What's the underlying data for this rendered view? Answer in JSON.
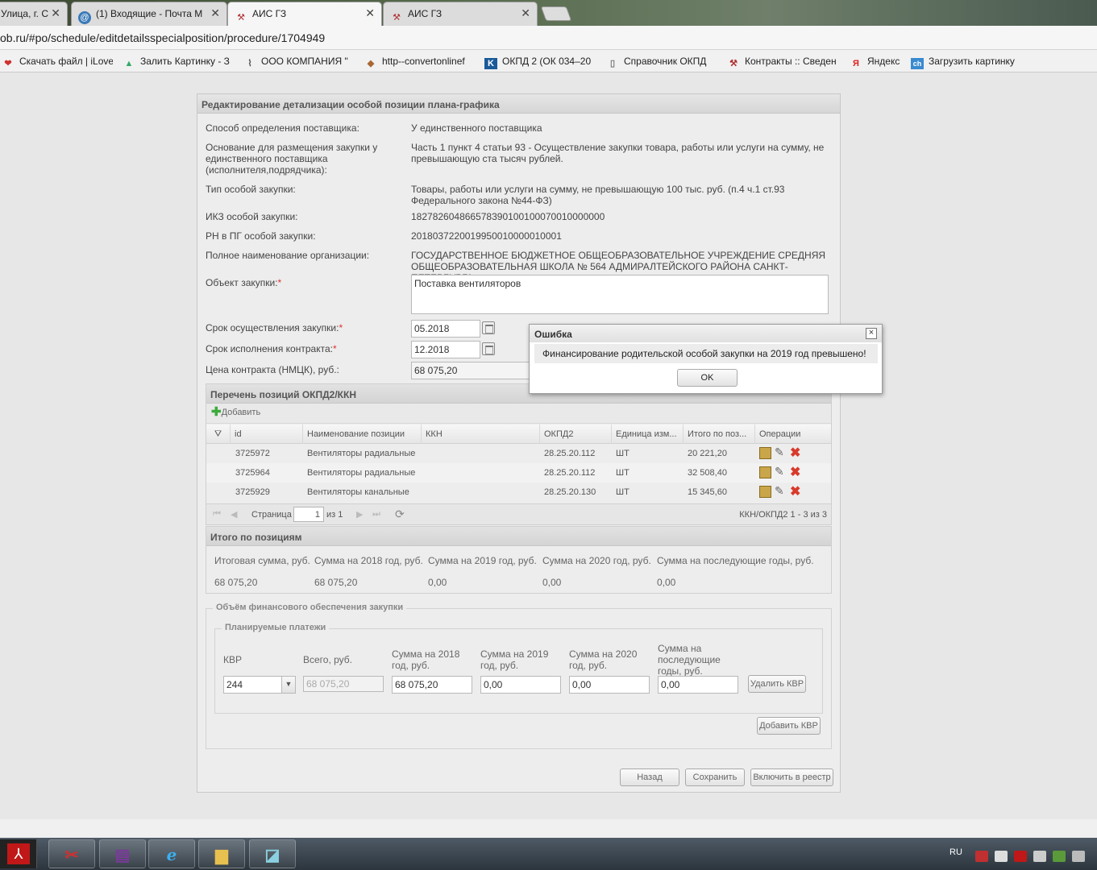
{
  "browser": {
    "tabs": [
      {
        "label": "Улица, г. С",
        "active": false,
        "icon": "map-icon"
      },
      {
        "label": "(1) Входящие - Почта M",
        "active": false,
        "icon": "mail-icon"
      },
      {
        "label": "АИС ГЗ",
        "active": true,
        "icon": "gavel-icon"
      },
      {
        "label": "АИС ГЗ",
        "active": false,
        "icon": "gavel-icon"
      }
    ],
    "address": "ob.ru/#po/schedule/editdetailsspecialposition/procedure/1704949",
    "bookmarks": [
      {
        "label": "Скачать файл | iLove",
        "icon": "heart-icon"
      },
      {
        "label": "Залить Картинку - З",
        "icon": "image-icon"
      },
      {
        "label": "ООО КОМПАНИЯ \"",
        "icon": "paperclip-icon"
      },
      {
        "label": "http--convertonlinef",
        "icon": "convert-icon"
      },
      {
        "label": "ОКПД 2 (ОК 034–20",
        "icon": "k-icon"
      },
      {
        "label": "Справочник ОКПД",
        "icon": "page-icon"
      },
      {
        "label": "Контракты :: Сведен",
        "icon": "gavel-icon"
      },
      {
        "label": "Яндекс",
        "icon": "yandex-icon"
      },
      {
        "label": "Загрузить картинку",
        "icon": "ch-icon"
      }
    ]
  },
  "form": {
    "title": "Редактирование детализации особой позиции плана-графика",
    "fields": {
      "method_label": "Способ определения поставщика:",
      "method_value": "У единственного поставщика",
      "basis_label": "Основание для размещения закупки у единственного поставщика (исполнителя,подрядчика):",
      "basis_value": "Часть 1 пункт 4 статьи 93 - Осуществление закупки товара, работы или услуги на сумму, не превышающую ста тысяч рублей.",
      "type_label": "Тип особой закупки:",
      "type_value": "Товары, работы или услуги на сумму, не превышающую 100 тыс. руб. (п.4 ч.1 ст.93 Федерального закона №44-ФЗ)",
      "ikz_label": "ИКЗ особой закупки:",
      "ikz_value": "182782604866578390100100070010000000",
      "rn_label": "РН в ПГ особой закупки:",
      "rn_value": "2018037220019950010000010001",
      "org_label": "Полное наименование организации:",
      "org_value": "ГОСУДАРСТВЕННОЕ БЮДЖЕТНОЕ ОБЩЕОБРАЗОВАТЕЛЬНОЕ УЧРЕЖДЕНИЕ СРЕДНЯЯ ОБЩЕОБРАЗОВАТЕЛЬНАЯ ШКОЛА № 564 АДМИРАЛТЕЙСКОГО РАЙОНА САНКТ-ПЕТЕРБУРГА",
      "object_label": "Объект закупки:",
      "object_value": "Поставка вентиляторов",
      "term_label": "Срок осуществления закупки:",
      "term_value": "05.2018",
      "contract_term_label": "Срок исполнения контракта:",
      "contract_term_value": "12.2018",
      "price_label": "Цена контракта (НМЦК), руб.:",
      "price_value": "68 075,20",
      "required_mark": "*"
    },
    "positions": {
      "title": "Перечень позиций ОКПД2/ККН",
      "add_label": "Добавить",
      "columns": [
        "id",
        "Наименование позиции",
        "ККН",
        "ОКПД2",
        "Единица изм...",
        "Итого по поз...",
        "Операции"
      ],
      "rows": [
        {
          "id": "3725972",
          "name": "Вентиляторы радиальные",
          "kkn": "",
          "okpd": "28.25.20.112",
          "unit": "ШТ",
          "total": "20 221,20"
        },
        {
          "id": "3725964",
          "name": "Вентиляторы радиальные",
          "kkn": "",
          "okpd": "28.25.20.112",
          "unit": "ШТ",
          "total": "32 508,40"
        },
        {
          "id": "3725929",
          "name": "Вентиляторы канальные",
          "kkn": "",
          "okpd": "28.25.20.130",
          "unit": "ШТ",
          "total": "15 345,60"
        }
      ],
      "pager": {
        "page_label": "Страница",
        "page": "1",
        "of_label": "из 1",
        "summary": "ККН/ОКПД2 1 - 3 из 3"
      }
    },
    "totals": {
      "title": "Итого по позициям",
      "headers": [
        "Итоговая сумма, руб.",
        "Сумма на 2018 год, руб.",
        "Сумма на 2019 год, руб.",
        "Сумма на 2020 год, руб.",
        "Сумма на последующие годы, руб."
      ],
      "values": [
        "68 075,20",
        "68 075,20",
        "0,00",
        "0,00",
        "0,00"
      ]
    },
    "finance": {
      "legend": "Объём финансового обеспечения закупки",
      "sub_legend": "Планируемые платежи",
      "headers": {
        "kvr": "КВР",
        "total": "Всего, руб.",
        "y2018": "Сумма на 2018 год, руб.",
        "y2019": "Сумма на 2019 год, руб.",
        "y2020": "Сумма на 2020 год, руб.",
        "later": "Сумма на последующие годы, руб."
      },
      "row": {
        "kvr": "244",
        "total": "68 075,20",
        "y2018": "68 075,20",
        "y2019": "0,00",
        "y2020": "0,00",
        "later": "0,00"
      },
      "delete_kvr": "Удалить КВР",
      "add_kvr": "Добавить КВР"
    },
    "buttons": {
      "back": "Назад",
      "save": "Сохранить",
      "include": "Включить в реестр"
    }
  },
  "dialog": {
    "title": "Ошибка",
    "message": "Финансирование родительской особой закупки на 2019 год превышено!",
    "ok": "OK",
    "close": "×"
  },
  "taskbar": {
    "apps": [
      "acrobat-icon",
      "snipping-icon",
      "winrar-icon",
      "ie-icon",
      "explorer-icon",
      "notebook-icon"
    ],
    "lang": "RU"
  }
}
